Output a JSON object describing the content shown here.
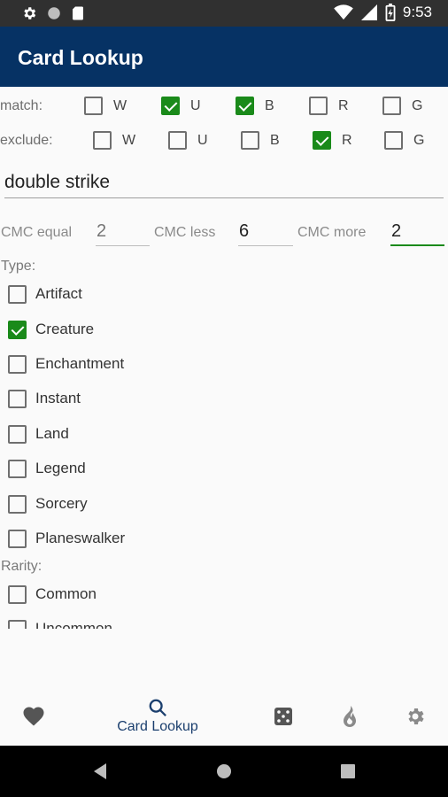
{
  "status_bar": {
    "time": "9:53",
    "left_icons": [
      "gear-icon",
      "circle-icon",
      "sd-card-icon"
    ],
    "right_icons": [
      "wifi-icon",
      "signal-icon",
      "battery-icon"
    ]
  },
  "app_bar": {
    "title": "Card Lookup"
  },
  "match": {
    "label": "match:",
    "options": [
      {
        "label": "W",
        "checked": false
      },
      {
        "label": "U",
        "checked": true
      },
      {
        "label": "B",
        "checked": true
      },
      {
        "label": "R",
        "checked": false
      },
      {
        "label": "G",
        "checked": false
      }
    ]
  },
  "exclude": {
    "label": "exclude:",
    "options": [
      {
        "label": "W",
        "checked": false
      },
      {
        "label": "U",
        "checked": false
      },
      {
        "label": "B",
        "checked": false
      },
      {
        "label": "R",
        "checked": true
      },
      {
        "label": "G",
        "checked": false
      }
    ]
  },
  "search": {
    "value": "double strike"
  },
  "cmc": {
    "equal_label": "CMC equal",
    "equal_placeholder": "2",
    "less_label": "CMC less",
    "less_value": "6",
    "more_label": "CMC more",
    "more_value": "2"
  },
  "type": {
    "label": "Type:",
    "options": [
      {
        "label": "Artifact",
        "checked": false
      },
      {
        "label": "Creature",
        "checked": true
      },
      {
        "label": "Enchantment",
        "checked": false
      },
      {
        "label": "Instant",
        "checked": false
      },
      {
        "label": "Land",
        "checked": false
      },
      {
        "label": "Legend",
        "checked": false
      },
      {
        "label": "Sorcery",
        "checked": false
      },
      {
        "label": "Planeswalker",
        "checked": false
      }
    ]
  },
  "rarity": {
    "label": "Rarity:",
    "options": [
      {
        "label": "Common",
        "checked": false
      },
      {
        "label": "Uncommon",
        "checked": false
      }
    ]
  },
  "bottom_nav": {
    "items": [
      {
        "icon": "heart-icon",
        "label": ""
      },
      {
        "icon": "search-icon",
        "label": "Card Lookup"
      },
      {
        "icon": "dice-icon",
        "label": ""
      },
      {
        "icon": "flame-icon",
        "label": ""
      },
      {
        "icon": "gear-icon",
        "label": ""
      }
    ]
  },
  "colors": {
    "app_bar": "#063264",
    "checked": "#1a8a1a",
    "nav_active": "#1b3f6e",
    "nav_inactive": "#555555"
  }
}
